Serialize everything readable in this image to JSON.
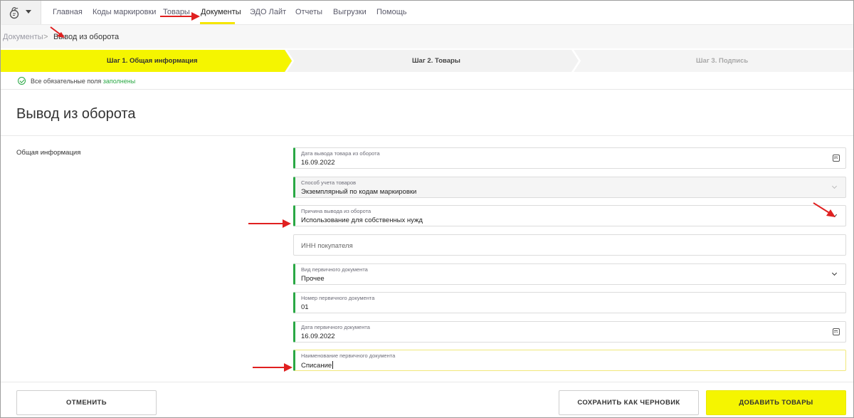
{
  "nav": {
    "items": [
      {
        "label": "Главная"
      },
      {
        "label": "Коды маркировки"
      },
      {
        "label": "Товары"
      },
      {
        "label": "Документы"
      },
      {
        "label": "ЭДО Лайт"
      },
      {
        "label": "Отчеты"
      },
      {
        "label": "Выгрузки"
      },
      {
        "label": "Помощь"
      }
    ],
    "active": "Документы"
  },
  "breadcrumb": {
    "root": "Документы",
    "separator": ">",
    "current": "Вывод из оборота"
  },
  "steps": [
    {
      "label": "Шаг 1. Общая информация",
      "state": "active"
    },
    {
      "label": "Шаг 2. Товары",
      "state": "next"
    },
    {
      "label": "Шаг 3. Подпись",
      "state": "disabled"
    }
  ],
  "validation": {
    "prefix": "Все обязательные поля",
    "status": "заполнены"
  },
  "page": {
    "title": "Вывод из оборота",
    "section_label": "Общая информация"
  },
  "fields": {
    "withdrawal_date": {
      "label": "Дата вывода товара из оборота",
      "value": "16.09.2022"
    },
    "accounting_method": {
      "label": "Способ учета товаров",
      "value": "Экземплярный по кодам маркировки"
    },
    "withdrawal_reason": {
      "label": "Причина вывода из оборота",
      "value": "Использование для собственных нужд"
    },
    "buyer_inn": {
      "placeholder": "ИНН покупателя"
    },
    "primary_doc_type": {
      "label": "Вид первичного документа",
      "value": "Прочее"
    },
    "primary_doc_number": {
      "label": "Номер первичного документа",
      "value": "01"
    },
    "primary_doc_date": {
      "label": "Дата первичного документа",
      "value": "16.09.2022"
    },
    "primary_doc_name": {
      "label": "Наименование первичного документа",
      "value": "Списание"
    }
  },
  "footer": {
    "cancel_label": "ОТМЕНИТЬ",
    "save_draft_label": "СОХРАНИТЬ КАК ЧЕРНОВИК",
    "add_goods_label": "ДОБАВИТЬ ТОВАРЫ"
  },
  "colors": {
    "accent_yellow": "#f5f500",
    "valid_green": "#2aa845",
    "annotation_red": "#e02020"
  }
}
